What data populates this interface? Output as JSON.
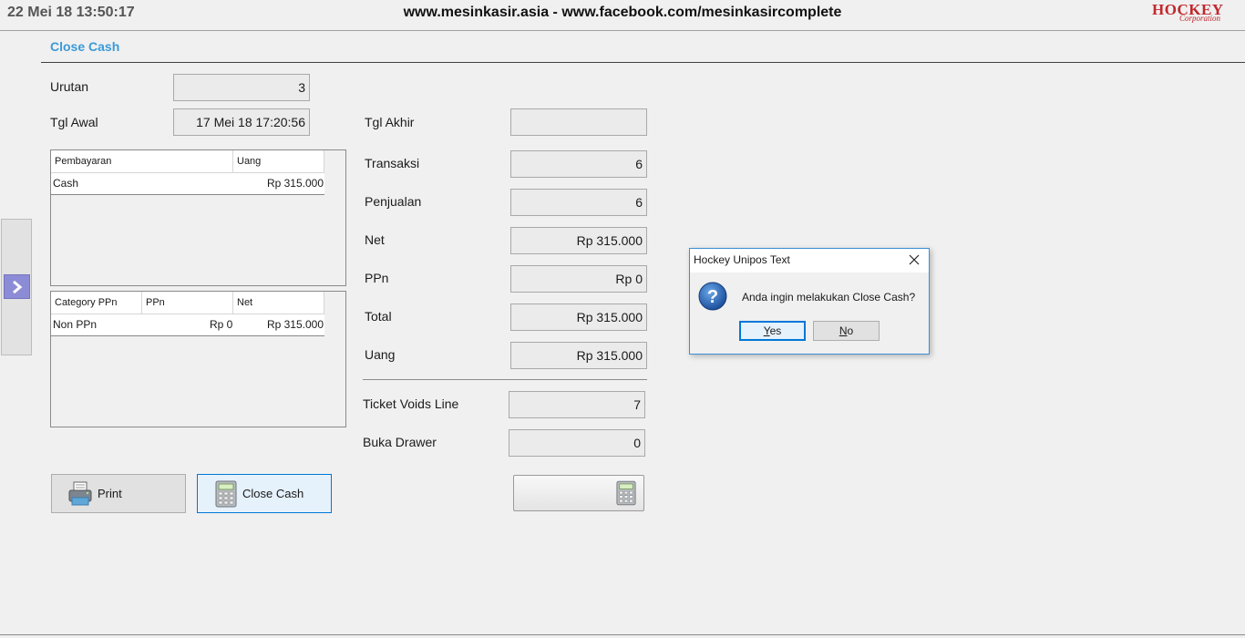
{
  "header": {
    "clock": "22 Mei 18 13:50:17",
    "website": "www.mesinkasir.asia - www.facebook.com/mesinkasircomplete",
    "logo_line1": "HOCKEY",
    "logo_line2": "Corporation"
  },
  "page_title": "Close Cash",
  "form": {
    "urutan_label": "Urutan",
    "urutan_value": "3",
    "tgl_awal_label": "Tgl Awal",
    "tgl_awal_value": "17 Mei 18 17:20:56",
    "tgl_akhir_label": "Tgl Akhir",
    "tgl_akhir_value": "",
    "transaksi_label": "Transaksi",
    "transaksi_value": "6",
    "penjualan_label": "Penjualan",
    "penjualan_value": "6",
    "net_label": "Net",
    "net_value": "Rp 315.000",
    "ppn_label": "PPn",
    "ppn_value": "Rp 0",
    "total_label": "Total",
    "total_value": "Rp 315.000",
    "uang_label": "Uang",
    "uang_value": "Rp 315.000",
    "ticket_voids_label": "Ticket Voids Line",
    "ticket_voids_value": "7",
    "buka_drawer_label": "Buka Drawer",
    "buka_drawer_value": "0"
  },
  "payments_table": {
    "headers": [
      "Pembayaran",
      "Uang"
    ],
    "rows": [
      [
        "Cash",
        "Rp 315.000"
      ]
    ]
  },
  "tax_table": {
    "headers": [
      "Category PPn",
      "PPn",
      "Net"
    ],
    "rows": [
      [
        "Non PPn",
        "Rp 0",
        "Rp 315.000"
      ]
    ]
  },
  "buttons": {
    "print": "Print",
    "close_cash": "Close Cash"
  },
  "dialog": {
    "title": "Hockey Unipos Text",
    "message": "Anda ingin melakukan Close Cash?",
    "yes_first": "Y",
    "yes_rest": "es",
    "no_first": "N",
    "no_rest": "o"
  },
  "colors": {
    "accent": "#3a9ad9",
    "brand": "#c0282d",
    "side_button": "#8c8cd6"
  }
}
